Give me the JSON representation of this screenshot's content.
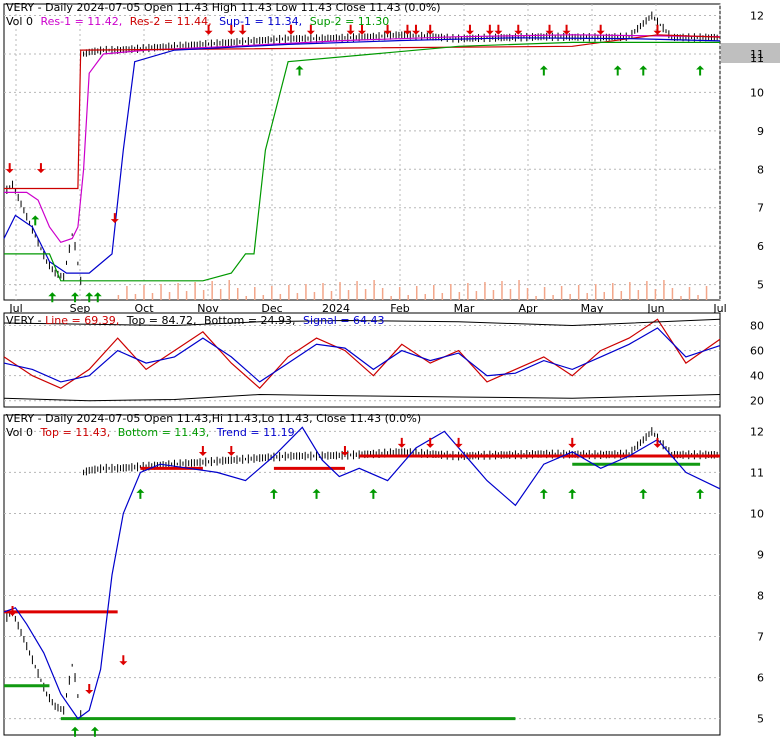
{
  "chart_data": [
    {
      "type": "candlestick",
      "title": "VERY - Daily 2024-07-05 Open 11.43  High 11.43  Low 11.43  Close 11.43 (0.0%)",
      "legend": [
        {
          "text": "Vol 0",
          "color": "#000000"
        },
        {
          "text": "Res-1 = 11.42,",
          "color": "#cc00cc"
        },
        {
          "text": "Res-2 = 11.44,",
          "color": "#cc0000"
        },
        {
          "text": "Sup-1 = 11.34,",
          "color": "#0000cc"
        },
        {
          "text": "Sup-2 = 11.30",
          "color": "#009900"
        }
      ],
      "ylim": [
        4.6,
        12.3
      ],
      "y_ticks": [
        "12",
        "11",
        "10",
        "9",
        "8",
        "7",
        "6",
        "5"
      ],
      "x_ticks": [
        "Jul",
        "Sep",
        "Oct",
        "Nov",
        "Dec",
        "2024",
        "Feb",
        "Mar",
        "Apr",
        "May",
        "Jun",
        "Jul"
      ],
      "last_price": "11",
      "price_series": {
        "x": [
          0,
          3,
          6,
          9,
          12,
          15,
          18,
          21,
          24,
          25,
          27,
          28,
          30,
          35,
          40,
          50,
          60,
          70,
          80,
          90,
          100,
          110,
          120,
          130,
          140,
          150,
          160,
          170,
          180,
          190,
          200,
          210,
          220,
          228,
          235,
          245,
          252
        ],
        "y": [
          7.4,
          7.6,
          7.1,
          6.6,
          6.1,
          5.6,
          5.3,
          5.2,
          6.3,
          6.0,
          5.1,
          11.0,
          11.05,
          11.1,
          11.1,
          11.15,
          11.2,
          11.25,
          11.3,
          11.35,
          11.4,
          11.4,
          11.42,
          11.45,
          11.5,
          11.45,
          11.4,
          11.42,
          11.43,
          11.45,
          11.44,
          11.43,
          11.45,
          12.0,
          11.43,
          11.43,
          11.43
        ]
      },
      "series": [
        {
          "name": "Res-1",
          "color": "#cc00cc",
          "x": [
            0,
            8,
            12,
            16,
            20,
            24,
            26,
            28,
            30,
            35,
            50,
            80,
            120,
            160,
            200,
            252
          ],
          "y": [
            7.4,
            7.4,
            7.2,
            6.5,
            6.1,
            6.2,
            6.5,
            8.0,
            10.5,
            11.0,
            11.1,
            11.2,
            11.35,
            11.45,
            11.5,
            11.45
          ]
        },
        {
          "name": "Res-2",
          "color": "#cc0000",
          "x": [
            0,
            26,
            27,
            200,
            230,
            252
          ],
          "y": [
            7.5,
            7.5,
            11.1,
            11.2,
            11.5,
            11.44
          ]
        },
        {
          "name": "Sup-1",
          "color": "#0000cc",
          "x": [
            0,
            4,
            10,
            16,
            22,
            30,
            38,
            42,
            46,
            60,
            100,
            140,
            180,
            220,
            252
          ],
          "y": [
            6.2,
            6.8,
            6.5,
            5.6,
            5.3,
            5.3,
            5.8,
            8.5,
            10.8,
            11.1,
            11.25,
            11.35,
            11.42,
            11.4,
            11.34
          ]
        },
        {
          "name": "Sup-2",
          "color": "#009900",
          "x": [
            0,
            16,
            20,
            70,
            80,
            85,
            88,
            92,
            100,
            130,
            160,
            200,
            252
          ],
          "y": [
            5.8,
            5.8,
            5.1,
            5.1,
            5.3,
            5.8,
            5.8,
            8.5,
            10.8,
            11.0,
            11.2,
            11.3,
            11.3
          ]
        }
      ],
      "down_arrows": [
        [
          2,
          7.9
        ],
        [
          13,
          7.9
        ],
        [
          39,
          6.6
        ],
        [
          72,
          11.5
        ],
        [
          80,
          11.5
        ],
        [
          84,
          11.5
        ],
        [
          101,
          11.5
        ],
        [
          108,
          11.5
        ],
        [
          122,
          11.5
        ],
        [
          126,
          11.5
        ],
        [
          135,
          11.5
        ],
        [
          142,
          11.5
        ],
        [
          145,
          11.5
        ],
        [
          150,
          11.5
        ],
        [
          164,
          11.5
        ],
        [
          171,
          11.5
        ],
        [
          174,
          11.5
        ],
        [
          181,
          11.5
        ],
        [
          192,
          11.5
        ],
        [
          198,
          11.5
        ],
        [
          210,
          11.5
        ],
        [
          230,
          11.5
        ]
      ],
      "up_arrows": [
        [
          11,
          6.8
        ],
        [
          17,
          4.8
        ],
        [
          25,
          4.8
        ],
        [
          30,
          4.8
        ],
        [
          33,
          4.8
        ],
        [
          104,
          10.7
        ],
        [
          190,
          10.7
        ],
        [
          216,
          10.7
        ],
        [
          225,
          10.7
        ],
        [
          245,
          10.7
        ]
      ]
    },
    {
      "type": "line",
      "title_prefix": "VERY - ",
      "legend": [
        {
          "text": "Line = 69.39,",
          "color": "#cc0000"
        },
        {
          "text": "Top = 84.72,",
          "color": "#000000"
        },
        {
          "text": "Bottom = 24.93,",
          "color": "#000000"
        },
        {
          "text": "Signal = 64.43",
          "color": "#0000cc"
        }
      ],
      "ylim": [
        15,
        90
      ],
      "y_ticks": [
        "80",
        "60",
        "40",
        "20"
      ],
      "series": [
        {
          "name": "Line",
          "color": "#cc0000",
          "x": [
            0,
            10,
            20,
            30,
            40,
            50,
            60,
            70,
            80,
            90,
            100,
            110,
            120,
            130,
            140,
            150,
            160,
            170,
            180,
            190,
            200,
            210,
            220,
            230,
            240,
            252
          ],
          "y": [
            55,
            40,
            30,
            45,
            70,
            45,
            60,
            75,
            50,
            30,
            55,
            70,
            60,
            40,
            65,
            50,
            60,
            35,
            45,
            55,
            40,
            60,
            70,
            85,
            50,
            69
          ]
        },
        {
          "name": "Signal",
          "color": "#0000cc",
          "x": [
            0,
            10,
            20,
            30,
            40,
            50,
            60,
            70,
            80,
            90,
            100,
            110,
            120,
            130,
            140,
            150,
            160,
            170,
            180,
            190,
            200,
            210,
            220,
            230,
            240,
            252
          ],
          "y": [
            50,
            45,
            35,
            40,
            60,
            50,
            55,
            70,
            55,
            35,
            50,
            65,
            62,
            45,
            60,
            52,
            58,
            40,
            42,
            52,
            45,
            55,
            65,
            78,
            55,
            64
          ]
        },
        {
          "name": "Top",
          "color": "#000000",
          "x": [
            0,
            30,
            60,
            90,
            120,
            160,
            200,
            252
          ],
          "y": [
            82,
            81,
            80,
            83,
            84,
            83,
            80,
            85
          ]
        },
        {
          "name": "Bottom",
          "color": "#000000",
          "x": [
            0,
            30,
            60,
            90,
            120,
            160,
            200,
            252
          ],
          "y": [
            22,
            20,
            21,
            25,
            24,
            23,
            22,
            25
          ]
        }
      ]
    },
    {
      "type": "candlestick",
      "title": "VERY - Daily 2024-07-05 Open 11.43,Hi 11.43,Lo 11.43, Close 11.43 (0.0%)",
      "legend": [
        {
          "text": "Vol 0",
          "color": "#000000"
        },
        {
          "text": "Top = 11.43,",
          "color": "#cc0000"
        },
        {
          "text": "Bottom = 11.43,",
          "color": "#009900"
        },
        {
          "text": "Trend = 11.19",
          "color": "#0000cc"
        }
      ],
      "ylim": [
        4.6,
        12.4
      ],
      "y_ticks": [
        "12",
        "11",
        "10",
        "9",
        "8",
        "7",
        "6",
        "5"
      ],
      "series": [
        {
          "name": "Trend",
          "color": "#0000cc",
          "x": [
            0,
            4,
            8,
            14,
            20,
            26,
            30,
            34,
            38,
            42,
            48,
            55,
            65,
            75,
            85,
            95,
            105,
            112,
            118,
            125,
            135,
            145,
            155,
            165,
            170,
            180,
            190,
            200,
            210,
            220,
            230,
            240,
            252
          ],
          "y": [
            7.6,
            7.7,
            7.3,
            6.6,
            5.6,
            5.0,
            5.2,
            6.2,
            8.5,
            10.0,
            11.0,
            11.2,
            11.1,
            11.0,
            10.8,
            11.4,
            12.1,
            11.3,
            10.9,
            11.1,
            10.8,
            11.6,
            12.0,
            11.2,
            10.8,
            10.2,
            11.2,
            11.5,
            11.1,
            11.4,
            11.8,
            11.0,
            10.6
          ]
        }
      ],
      "top_segments": [
        [
          0,
          40,
          7.6
        ],
        [
          48,
          70,
          11.1
        ],
        [
          95,
          120,
          11.1
        ],
        [
          125,
          252,
          11.4
        ]
      ],
      "bottom_segments": [
        [
          0,
          16,
          5.8
        ],
        [
          20,
          180,
          5.0
        ],
        [
          200,
          245,
          11.2
        ]
      ],
      "down_arrows": [
        [
          3,
          7.5
        ],
        [
          30,
          5.6
        ],
        [
          42,
          6.3
        ],
        [
          70,
          11.4
        ],
        [
          80,
          11.4
        ],
        [
          120,
          11.4
        ],
        [
          140,
          11.6
        ],
        [
          150,
          11.6
        ],
        [
          160,
          11.6
        ],
        [
          200,
          11.6
        ],
        [
          230,
          11.6
        ]
      ],
      "up_arrows": [
        [
          25,
          4.8
        ],
        [
          32,
          4.8
        ],
        [
          48,
          10.6
        ],
        [
          95,
          10.6
        ],
        [
          110,
          10.6
        ],
        [
          130,
          10.6
        ],
        [
          190,
          10.6
        ],
        [
          200,
          10.6
        ],
        [
          225,
          10.6
        ],
        [
          245,
          10.6
        ]
      ]
    }
  ]
}
